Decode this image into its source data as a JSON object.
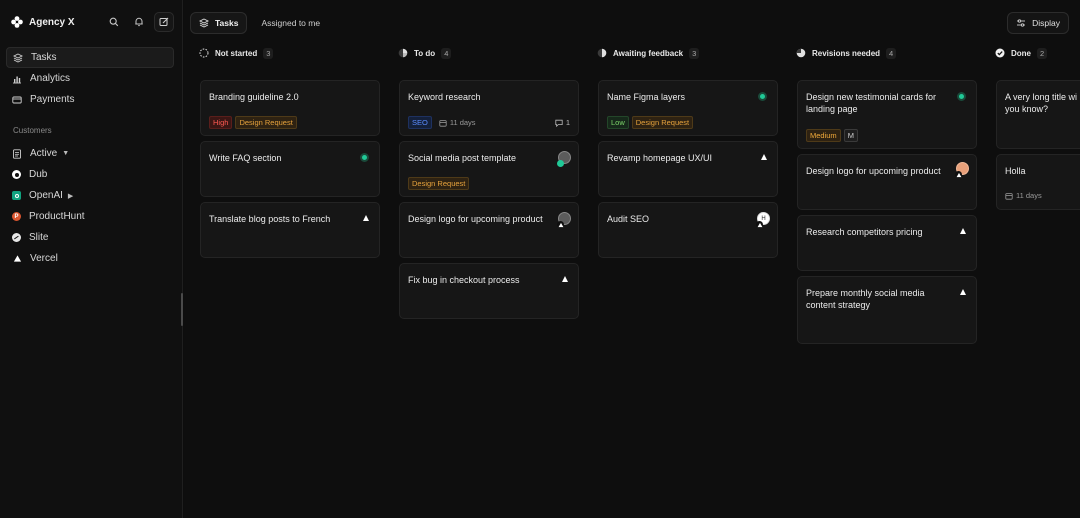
{
  "app": {
    "name": "Agency X"
  },
  "nav": [
    {
      "label": "Tasks",
      "icon": "layers-icon",
      "active": true
    },
    {
      "label": "Analytics",
      "icon": "bar-chart-icon",
      "active": false
    },
    {
      "label": "Payments",
      "icon": "card-icon",
      "active": false
    }
  ],
  "customers": {
    "section_label": "Customers",
    "filter_label": "Active",
    "items": [
      {
        "label": "Dub",
        "icon": "dub-logo"
      },
      {
        "label": "OpenAI",
        "icon": "openai-logo",
        "has_children": true
      },
      {
        "label": "ProductHunt",
        "icon": "producthunt-logo"
      },
      {
        "label": "Slite",
        "icon": "slite-logo"
      },
      {
        "label": "Vercel",
        "icon": "vercel-logo"
      }
    ]
  },
  "tabs": [
    {
      "label": "Tasks",
      "active": true
    },
    {
      "label": "Assigned to me",
      "active": false
    }
  ],
  "display_button": "Display",
  "colors": {
    "high": "#ff5a52",
    "design_request": "#e6a23c",
    "seo": "#5b8cff",
    "low": "#7cd46a",
    "green": "#20c997"
  },
  "columns": [
    {
      "title": "Not started",
      "count": "3",
      "cards": [
        {
          "title": "Branding guideline 2.0",
          "tags": [
            "High",
            "Design Request"
          ]
        },
        {
          "title": "Write FAQ section",
          "marker": "green"
        },
        {
          "title": "Translate blog posts to French",
          "marker": "triangle"
        }
      ]
    },
    {
      "title": "To do",
      "count": "4",
      "cards": [
        {
          "title": "Keyword research",
          "tags": [
            "SEO"
          ],
          "due": "11 days",
          "comments": "1"
        },
        {
          "title": "Social media post template",
          "tags": [
            "Design Request"
          ],
          "marker": "avatar"
        },
        {
          "title": "Design logo for upcoming product",
          "marker": "avatar"
        },
        {
          "title": "Fix bug in checkout process",
          "marker": "triangle"
        }
      ]
    },
    {
      "title": "Awaiting feedback",
      "count": "3",
      "cards": [
        {
          "title": "Name Figma layers",
          "tags": [
            "Low",
            "Design Request"
          ],
          "marker": "green"
        },
        {
          "title": "Revamp homepage UX/UI",
          "marker": "triangle"
        },
        {
          "title": "Audit SEO",
          "marker": "avatar",
          "avatar_initial": "H"
        }
      ]
    },
    {
      "title": "Revisions needed",
      "count": "4",
      "cards": [
        {
          "title": "Design new testimonial cards for landing page",
          "tags": [
            "Medium",
            "M"
          ],
          "marker": "green"
        },
        {
          "title": "Design logo for upcoming product",
          "marker": "avatar"
        },
        {
          "title": "Research competitors pricing",
          "marker": "triangle"
        },
        {
          "title": "Prepare monthly social media content strategy",
          "marker": "triangle"
        }
      ]
    },
    {
      "title": "Done",
      "count": "2",
      "cards": [
        {
          "title": "A very long title wi you know?"
        },
        {
          "title": "Holla",
          "due": "11 days"
        }
      ]
    }
  ]
}
